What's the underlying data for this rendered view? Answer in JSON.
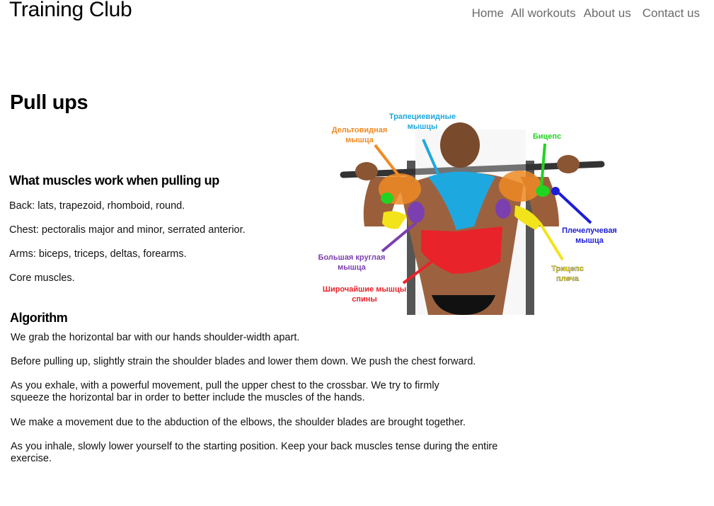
{
  "header": {
    "brand": "Training Club",
    "nav": [
      "Home",
      "All workouts",
      "About us",
      "Contact us"
    ]
  },
  "page": {
    "title": "Pull ups",
    "muscles_heading": "What muscles work when pulling up",
    "muscles": [
      "Back: lats, trapezoid, rhomboid, round.",
      "Chest: pectoralis major and minor, serrated anterior.",
      "Arms: biceps, triceps, deltas, forearms.",
      "Core muscles."
    ],
    "algorithm_heading": "Algorithm",
    "steps": [
      "We grab the horizontal bar with our hands shoulder-width apart.",
      "Before pulling up, slightly strain the shoulder blades and lower them down. We push the chest forward.",
      "As you exhale, with a powerful movement, pull the upper chest to the crossbar. We try to firmly squeeze the horizontal bar in order to better include the muscles of the hands.",
      "We make a movement due to the abduction of the elbows, the shoulder blades are brought together.",
      "As you inhale, slowly lower yourself to the starting position. Keep your back muscles tense during the entire exercise."
    ]
  },
  "figure": {
    "labels": {
      "trapezius_1": "Трапециевидные",
      "trapezius_2": "мышцы",
      "deltoid_1": "Дельтовидная",
      "deltoid_2": "мышца",
      "biceps": "Бицепс",
      "brachioradialis_1": "Плечелучевая",
      "brachioradialis_2": "мышца",
      "teres_1": "Большая круглая",
      "teres_2": "мышца",
      "triceps_1": "Трицепс",
      "triceps_2": "плеча",
      "lats_1": "Широчайшие мышцы",
      "lats_2": "спины"
    },
    "colors": {
      "trapezius": "#1ea8e0",
      "deltoid": "#f08a24",
      "biceps": "#22d322",
      "brachioradialis": "#1c1cd8",
      "teres": "#7b3fb0",
      "triceps": "#f2e31a",
      "lats": "#e8232a"
    }
  }
}
